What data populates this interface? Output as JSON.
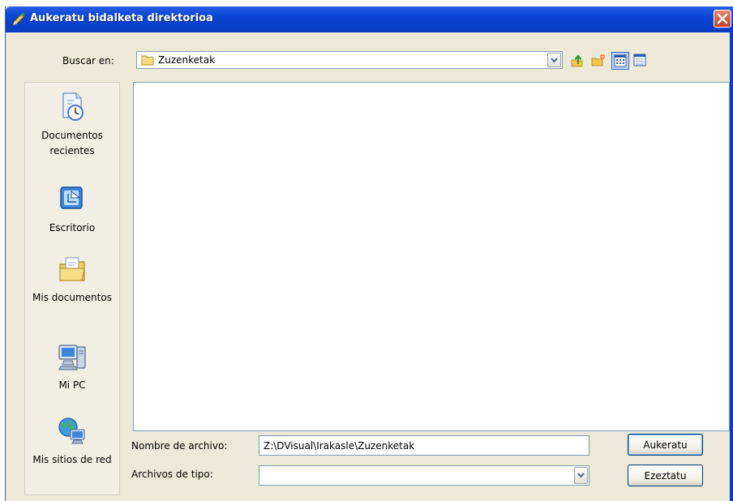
{
  "window": {
    "title": "Aukeratu bidalketa direktorioa",
    "icons": {
      "app": "app-pencil-icon",
      "close": "close-icon"
    }
  },
  "toolbar": {
    "lookin_label": "Buscar en:",
    "lookin_value": "Zuzenketak",
    "buttons": [
      "up-folder-icon",
      "new-folder-icon",
      "view-list-icon",
      "view-details-icon"
    ]
  },
  "places": [
    {
      "label": "Documentos recientes",
      "icon": "recent-documents-icon"
    },
    {
      "label": "Escritorio",
      "icon": "desktop-icon"
    },
    {
      "label": "Mis documentos",
      "icon": "my-documents-icon"
    },
    {
      "label": "Mi PC",
      "icon": "my-computer-icon"
    },
    {
      "label": "Mis sitios de red",
      "icon": "network-places-icon"
    }
  ],
  "file_list": {
    "items": []
  },
  "filename": {
    "label": "Nombre de archivo:",
    "value": "Z:\\DVisual\\Irakasle\\Zuzenketak"
  },
  "filetype": {
    "label": "Archivos de tipo:",
    "value": ""
  },
  "buttons": {
    "ok": "Aukeratu",
    "cancel": "Ezeztatu"
  },
  "colors": {
    "titlebar": "#0a46d8",
    "dialog_bg": "#ece9d8",
    "border": "#7f9db9"
  }
}
